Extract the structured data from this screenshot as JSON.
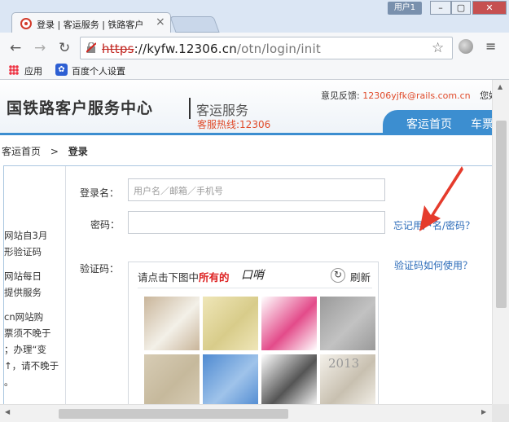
{
  "browser": {
    "tab_title": "登录 | 客运服务 | 铁路客户",
    "tab_close": "×",
    "user_label": "用户1",
    "win_min": "–",
    "win_max": "▢",
    "win_close": "✕",
    "url_scheme": "https",
    "url_host": "://kyfw.12306.cn",
    "url_path": "/otn/login/init",
    "bookmarks": [
      {
        "label": "应用",
        "icon": "apps-icon"
      },
      {
        "label": "百度个人设置",
        "icon": "baidu-paw-icon"
      }
    ]
  },
  "header": {
    "site_title": "国铁路客户服务中心",
    "section": "客运服务",
    "hotline": "客服热线:12306",
    "feedback_label": "意见反馈:",
    "feedback_email": "12306yjfk@rails.com.cn",
    "greeting": "您好",
    "nav": [
      "客运首页",
      "车票"
    ]
  },
  "breadcrumb": {
    "parent": "客运首页",
    "separator": ">",
    "current": "登录"
  },
  "notice_fragments": [
    "网站自3月",
    "形验证码",
    "网站每日",
    "提供服务",
    "cn网站购",
    "票须不晚于",
    "；办理“变",
    "↑，请不晚于",
    "。"
  ],
  "login": {
    "username_label": "登录名：",
    "username_placeholder": "用户名／邮箱／手机号",
    "password_label": "密码：",
    "password_placeholder": "",
    "forgot_link": "忘记用户名/密码？",
    "captcha_label": "验证码：",
    "captcha_help_link": "验证码如何使用？",
    "captcha_prompt_prefix": "请点击下图中",
    "captcha_prompt_highlight": "所有的",
    "captcha_target_word": "口哨",
    "refresh_label": "刷新"
  },
  "captcha_images": [
    {
      "name": "marshmallows-image",
      "colors": [
        "#c9b59a",
        "#f3f0e8"
      ]
    },
    {
      "name": "calendar-image",
      "colors": [
        "#efe6b8",
        "#d8cc8a"
      ]
    },
    {
      "name": "colored-pens-image",
      "colors": [
        "#ffffff",
        "#e34b8a"
      ]
    },
    {
      "name": "grey-texture-image",
      "colors": [
        "#9a9a9a",
        "#c2c2c2"
      ]
    },
    {
      "name": "tiles-image",
      "colors": [
        "#d7ccb5",
        "#c6b99c"
      ]
    },
    {
      "name": "chimney-image",
      "colors": [
        "#4f8ad1",
        "#9fc3ea"
      ]
    },
    {
      "name": "zipper-image",
      "colors": [
        "#ffffff",
        "#555555"
      ]
    },
    {
      "name": "calendar-2013-image",
      "colors": [
        "#f4f1ea",
        "#c8c0b0"
      ]
    }
  ],
  "captcha_calendar_year": "2013",
  "annotation": {
    "color": "#e53b2c"
  }
}
